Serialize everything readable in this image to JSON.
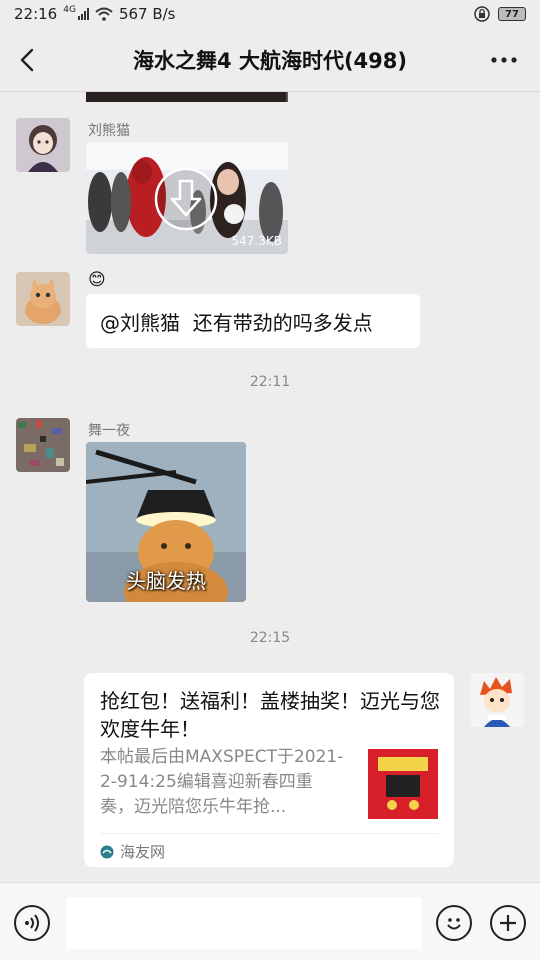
{
  "status": {
    "time": "22:16",
    "network": "4G",
    "speed": "567 B/s",
    "battery": "77"
  },
  "header": {
    "title": "海水之舞4 大航海时代(498)"
  },
  "messages": {
    "m1": {
      "sender": "刘熊猫",
      "image_size": "547.3KB"
    },
    "m2": {
      "emoji": "😊",
      "text": "@刘熊猫  还有带劲的吗多发点"
    },
    "t1": "22:11",
    "m3": {
      "sender": "舞一夜",
      "caption": "头脑发热"
    },
    "t2": "22:15",
    "m4": {
      "title": "抢红包！送福利！盖楼抽奖！迈光与您欢度牛年！",
      "desc": "本帖最后由MAXSPECT于2021-2-914:25编辑喜迎新春四重奏，迈光陪您乐牛年抢...",
      "source": "海友网"
    }
  },
  "colors": {
    "bg": "#ededed",
    "bubble": "#ffffff",
    "link_icon": "#2e7d8c"
  }
}
